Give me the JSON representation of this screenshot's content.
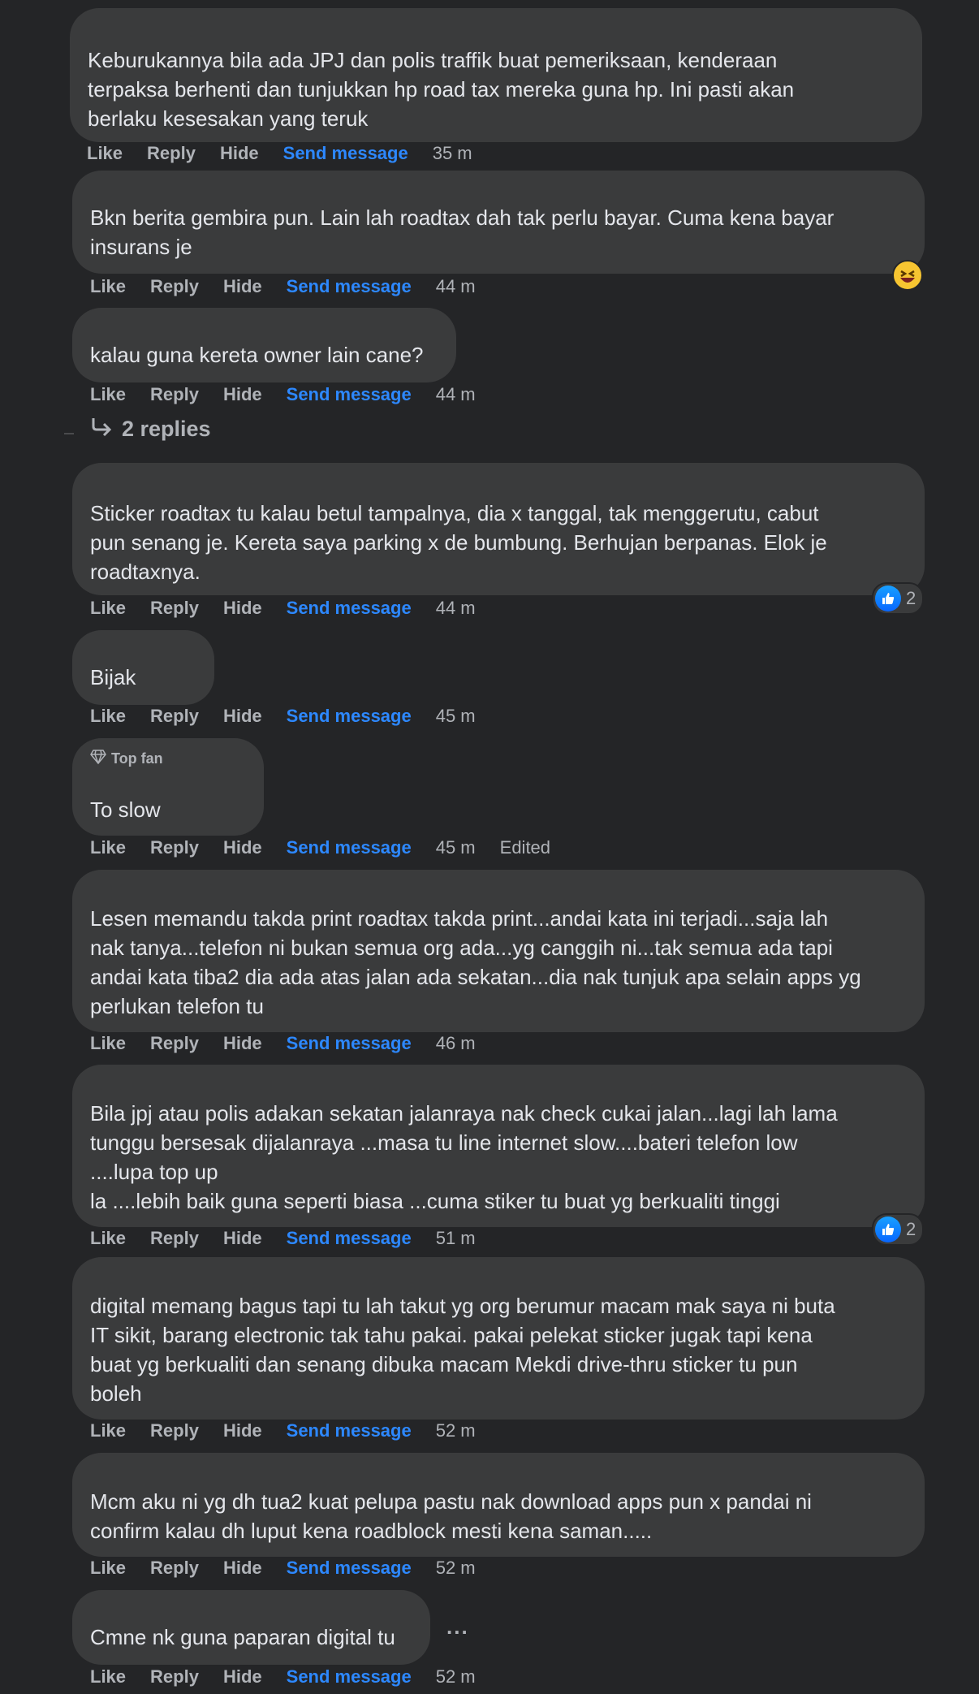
{
  "actions": {
    "like": "Like",
    "reply": "Reply",
    "hide": "Hide",
    "send": "Send message",
    "edited": "Edited"
  },
  "comments": [
    {
      "text": "Keburukannya bila ada JPJ dan polis traffik buat pemeriksaan, kenderaan\nterpaksa berhenti dan tunjukkan hp road tax mereka guna hp. Ini pasti akan\nberlaku kesesakan yang teruk",
      "time": "35 m"
    },
    {
      "text": "Bkn berita gembira pun. Lain lah roadtax dah tak perlu bayar. Cuma kena bayar\ninsurans je",
      "time": "44 m",
      "reaction": "laughing-emoji"
    },
    {
      "text": "kalau guna kereta owner lain cane?",
      "time": "44 m"
    },
    {
      "text": "Sticker roadtax tu kalau betul tampalnya, dia x tanggal, tak menggerutu, cabut\npun senang je. Kereta saya parking x de bumbung. Berhujan berpanas. Elok je\nroadtaxnya.",
      "time": "44 m",
      "reaction_count": "2"
    },
    {
      "text": "Bijak",
      "time": "45 m"
    },
    {
      "badge": "Top fan",
      "text": "To slow",
      "time": "45 m",
      "edited": true
    },
    {
      "text": "Lesen memandu takda print roadtax takda print...andai kata ini terjadi...saja lah\nnak tanya...telefon ni bukan semua org ada...yg canggih ni...tak semua ada tapi\nandai kata tiba2 dia ada atas jalan ada sekatan...dia nak tunjuk apa selain apps yg\nperlukan telefon tu",
      "time": "46 m"
    },
    {
      "text": "Bila jpj atau polis adakan sekatan jalanraya nak check cukai jalan...lagi lah lama\ntunggu bersesak dijalanraya ...masa tu line internet slow....bateri telefon low\n....lupa top up\nla ....lebih baik guna seperti biasa ...cuma stiker tu buat yg berkualiti tinggi",
      "time": "51 m",
      "reaction_count": "2"
    },
    {
      "text": "digital memang bagus tapi tu lah takut yg org berumur macam mak saya ni buta\nIT sikit, barang electronic tak tahu pakai. pakai pelekat sticker jugak tapi kena\nbuat yg berkualiti dan senang dibuka macam Mekdi drive-thru sticker tu pun\nboleh",
      "time": "52 m"
    },
    {
      "text": "Mcm aku ni yg dh tua2 kuat pelupa pastu nak download apps pun x pandai ni\nconfirm kalau dh luput kena roadblock mesti kena saman.....",
      "time": "52 m"
    },
    {
      "text": "Cmne nk guna paparan digital tu",
      "time": "52 m"
    }
  ],
  "replies_link": "2 replies",
  "more_glyph": "...",
  "colors": {
    "background": "#242527",
    "bubble": "#3a3b3c",
    "text": "#e4e6eb",
    "muted": "#b0b3b8",
    "accent": "#2d88ff"
  }
}
